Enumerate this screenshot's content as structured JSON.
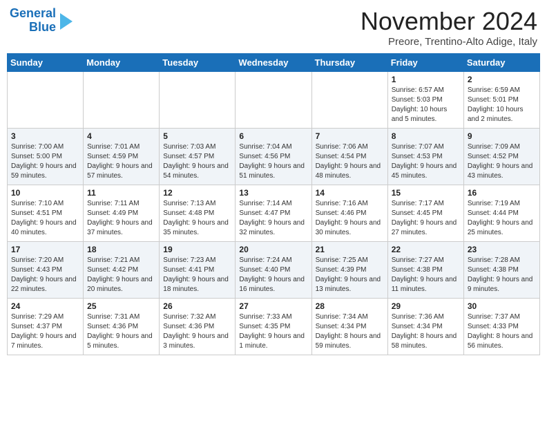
{
  "logo": {
    "line1": "General",
    "line2": "Blue"
  },
  "header": {
    "month": "November 2024",
    "location": "Preore, Trentino-Alto Adige, Italy"
  },
  "weekdays": [
    "Sunday",
    "Monday",
    "Tuesday",
    "Wednesday",
    "Thursday",
    "Friday",
    "Saturday"
  ],
  "weeks": [
    [
      {
        "day": "",
        "info": ""
      },
      {
        "day": "",
        "info": ""
      },
      {
        "day": "",
        "info": ""
      },
      {
        "day": "",
        "info": ""
      },
      {
        "day": "",
        "info": ""
      },
      {
        "day": "1",
        "info": "Sunrise: 6:57 AM\nSunset: 5:03 PM\nDaylight: 10 hours and 5 minutes."
      },
      {
        "day": "2",
        "info": "Sunrise: 6:59 AM\nSunset: 5:01 PM\nDaylight: 10 hours and 2 minutes."
      }
    ],
    [
      {
        "day": "3",
        "info": "Sunrise: 7:00 AM\nSunset: 5:00 PM\nDaylight: 9 hours and 59 minutes."
      },
      {
        "day": "4",
        "info": "Sunrise: 7:01 AM\nSunset: 4:59 PM\nDaylight: 9 hours and 57 minutes."
      },
      {
        "day": "5",
        "info": "Sunrise: 7:03 AM\nSunset: 4:57 PM\nDaylight: 9 hours and 54 minutes."
      },
      {
        "day": "6",
        "info": "Sunrise: 7:04 AM\nSunset: 4:56 PM\nDaylight: 9 hours and 51 minutes."
      },
      {
        "day": "7",
        "info": "Sunrise: 7:06 AM\nSunset: 4:54 PM\nDaylight: 9 hours and 48 minutes."
      },
      {
        "day": "8",
        "info": "Sunrise: 7:07 AM\nSunset: 4:53 PM\nDaylight: 9 hours and 45 minutes."
      },
      {
        "day": "9",
        "info": "Sunrise: 7:09 AM\nSunset: 4:52 PM\nDaylight: 9 hours and 43 minutes."
      }
    ],
    [
      {
        "day": "10",
        "info": "Sunrise: 7:10 AM\nSunset: 4:51 PM\nDaylight: 9 hours and 40 minutes."
      },
      {
        "day": "11",
        "info": "Sunrise: 7:11 AM\nSunset: 4:49 PM\nDaylight: 9 hours and 37 minutes."
      },
      {
        "day": "12",
        "info": "Sunrise: 7:13 AM\nSunset: 4:48 PM\nDaylight: 9 hours and 35 minutes."
      },
      {
        "day": "13",
        "info": "Sunrise: 7:14 AM\nSunset: 4:47 PM\nDaylight: 9 hours and 32 minutes."
      },
      {
        "day": "14",
        "info": "Sunrise: 7:16 AM\nSunset: 4:46 PM\nDaylight: 9 hours and 30 minutes."
      },
      {
        "day": "15",
        "info": "Sunrise: 7:17 AM\nSunset: 4:45 PM\nDaylight: 9 hours and 27 minutes."
      },
      {
        "day": "16",
        "info": "Sunrise: 7:19 AM\nSunset: 4:44 PM\nDaylight: 9 hours and 25 minutes."
      }
    ],
    [
      {
        "day": "17",
        "info": "Sunrise: 7:20 AM\nSunset: 4:43 PM\nDaylight: 9 hours and 22 minutes."
      },
      {
        "day": "18",
        "info": "Sunrise: 7:21 AM\nSunset: 4:42 PM\nDaylight: 9 hours and 20 minutes."
      },
      {
        "day": "19",
        "info": "Sunrise: 7:23 AM\nSunset: 4:41 PM\nDaylight: 9 hours and 18 minutes."
      },
      {
        "day": "20",
        "info": "Sunrise: 7:24 AM\nSunset: 4:40 PM\nDaylight: 9 hours and 16 minutes."
      },
      {
        "day": "21",
        "info": "Sunrise: 7:25 AM\nSunset: 4:39 PM\nDaylight: 9 hours and 13 minutes."
      },
      {
        "day": "22",
        "info": "Sunrise: 7:27 AM\nSunset: 4:38 PM\nDaylight: 9 hours and 11 minutes."
      },
      {
        "day": "23",
        "info": "Sunrise: 7:28 AM\nSunset: 4:38 PM\nDaylight: 9 hours and 9 minutes."
      }
    ],
    [
      {
        "day": "24",
        "info": "Sunrise: 7:29 AM\nSunset: 4:37 PM\nDaylight: 9 hours and 7 minutes."
      },
      {
        "day": "25",
        "info": "Sunrise: 7:31 AM\nSunset: 4:36 PM\nDaylight: 9 hours and 5 minutes."
      },
      {
        "day": "26",
        "info": "Sunrise: 7:32 AM\nSunset: 4:36 PM\nDaylight: 9 hours and 3 minutes."
      },
      {
        "day": "27",
        "info": "Sunrise: 7:33 AM\nSunset: 4:35 PM\nDaylight: 9 hours and 1 minute."
      },
      {
        "day": "28",
        "info": "Sunrise: 7:34 AM\nSunset: 4:34 PM\nDaylight: 8 hours and 59 minutes."
      },
      {
        "day": "29",
        "info": "Sunrise: 7:36 AM\nSunset: 4:34 PM\nDaylight: 8 hours and 58 minutes."
      },
      {
        "day": "30",
        "info": "Sunrise: 7:37 AM\nSunset: 4:33 PM\nDaylight: 8 hours and 56 minutes."
      }
    ]
  ]
}
